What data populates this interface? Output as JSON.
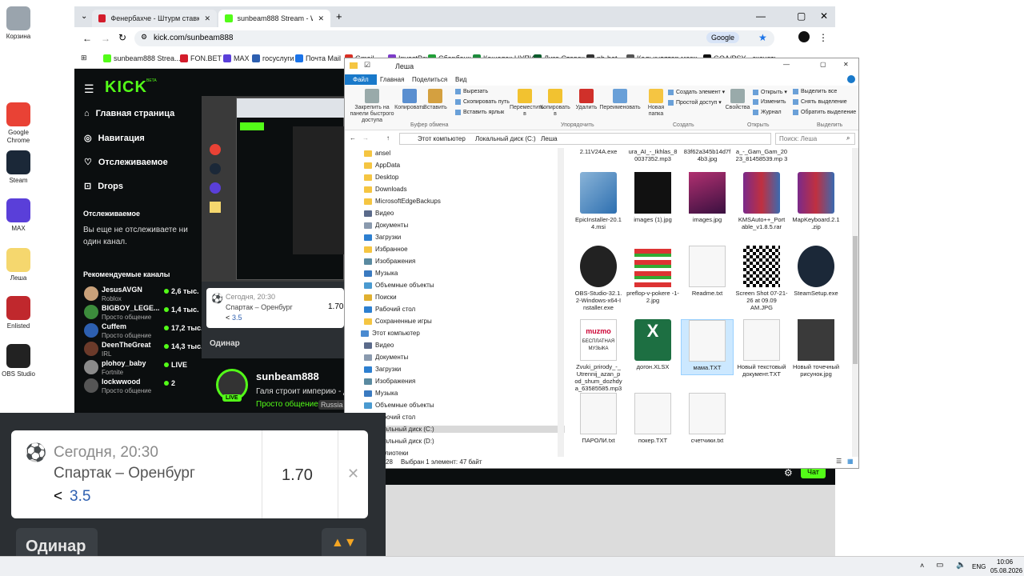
{
  "desktop": {
    "icons": [
      {
        "label": "Корзина",
        "color": "#9aa4ad"
      },
      {
        "label": "Google Chrome",
        "color": "#e94235"
      },
      {
        "label": "Steam",
        "color": "#1b2838"
      },
      {
        "label": "MAX",
        "color": "#5a3fd9"
      },
      {
        "label": "Леша",
        "color": "#f5d76e"
      },
      {
        "label": "Enlisted",
        "color": "#c0282d"
      },
      {
        "label": "OBS Studio",
        "color": "#222"
      }
    ]
  },
  "browser": {
    "tabs": [
      {
        "label": "Фенербахче - Штурм ставки ..."
      },
      {
        "label": "sunbeam888 Stream - Watch L..."
      }
    ],
    "url": "kick.com/sunbeam888",
    "google_label": "Google",
    "bookmarks": [
      "sunbeam888 Strea...",
      "FON.BET",
      "MAX",
      "госуслуги",
      "Почта Mail",
      "Gmail",
      "InvestPay",
      "Сбербанк",
      "Кошелек ЦУПИС",
      "Лига Ставок",
      "pb-bet",
      "Калькулятор маrж...",
      "GOA/PSY - скачать..."
    ]
  },
  "kick": {
    "logo": "KICK",
    "logo_beta": "BETA",
    "nav": [
      "Главная страница",
      "Навигация",
      "Отслеживаемое",
      "Drops"
    ],
    "following_title": "Отслеживаемое",
    "following_empty": "Вы еще не отслеживаете ни один канал.",
    "recommended_title": "Рекомендуемые каналы",
    "recommended": [
      {
        "name": "JesusAVGN",
        "sub": "Roblox",
        "viewers": "2,6 тыс.",
        "color": "#c9a17a"
      },
      {
        "name": "BIGBOY_LEGE...",
        "sub": "Просто общение",
        "viewers": "1,4 тыс.",
        "color": "#3c8c3c"
      },
      {
        "name": "Cuffem",
        "sub": "Просто общение",
        "viewers": "17,2 тыс.",
        "color": "#2d5fb0"
      },
      {
        "name": "DeenTheGreat",
        "sub": "IRL",
        "viewers": "14,3 тыс.",
        "color": "#6b3a2a"
      },
      {
        "name": "plohoy_baby",
        "sub": "Fortnite",
        "viewers": "LIVE",
        "color": "#8a8a8a"
      },
      {
        "name": "lockwwood",
        "sub": "Просто общение",
        "viewers": "2",
        "color": "#555"
      }
    ],
    "streamer": "sunbeam888",
    "stream_title": "Галя строит империю - д",
    "category": "Просто общение",
    "lang": "Russia",
    "live_badge": "LIVE",
    "chat_btn": "Чат"
  },
  "bet_small": {
    "time": "Сегодня, 20:30",
    "match": "Спартак – Оренбург",
    "sel_prefix": "<",
    "sel_val": "3.5",
    "odds": "1.70",
    "mode": "Одинар"
  },
  "bet_big": {
    "time": "Сегодня, 20:30",
    "match": "Спартак – Оренбург",
    "sel_prefix": "<",
    "sel_val": "3.5",
    "odds": "1.70",
    "mode": "Одинар"
  },
  "explorer": {
    "title": "Леша",
    "tabs": [
      "Файл",
      "Главная",
      "Поделиться",
      "Вид"
    ],
    "ribbon": {
      "clipboard": [
        "Закрепить на панели быстрого доступа",
        "Копировать",
        "Вставить"
      ],
      "clipboard_small": [
        "Вырезать",
        "Скопировать путь",
        "Вставить ярлык"
      ],
      "organize": [
        "Переместить в",
        "Копировать в",
        "Удалить",
        "Переименовать"
      ],
      "create": [
        "Новая папка"
      ],
      "create_small": [
        "Создать элемент ▾",
        "Простой доступ ▾"
      ],
      "open": [
        "Свойства"
      ],
      "open_small": [
        "Открыть ▾",
        "Изменить",
        "Журнал"
      ],
      "select_small": [
        "Выделить все",
        "Снять выделение",
        "Обратить выделение"
      ],
      "groups": [
        "Буфер обмена",
        "Упорядочить",
        "Создать",
        "Открыть",
        "Выделить"
      ]
    },
    "path": [
      "Этот компьютер",
      "Локальный диск (C:)",
      "Леша"
    ],
    "search_placeholder": "Поиск: Леша",
    "tree": [
      "ansel",
      "AppData",
      "Desktop",
      "Downloads",
      "MicrosoftEdgeBackups",
      "Видео",
      "Документы",
      "Загрузки",
      "Избранное",
      "Изображения",
      "Музыка",
      "Объемные объекты",
      "Поиски",
      "Рабочий стол",
      "Сохраненные игры",
      "Этот компьютер",
      "Видео",
      "Документы",
      "Загрузки",
      "Изображения",
      "Музыка",
      "Объемные объекты",
      "Рабочий стол",
      "Локальный диск (C:)",
      "Локальный диск (D:)",
      "Библиотеки"
    ],
    "top_files": [
      "2.11V24A.exe",
      "ura_AI_-_Ikhlas_8 0037352.mp3",
      "83f62a345b14d7f 4b3.jpg",
      "a_-_Gam_Gam_20 23_81458539.mp 3"
    ],
    "files": [
      {
        "name": "EpicInstaller-20.1 4.msi",
        "kind": "msi"
      },
      {
        "name": "images (1).jpg",
        "kind": "dark"
      },
      {
        "name": "images.jpg",
        "kind": "photo"
      },
      {
        "name": "KMSAuto++_Port able_v1.8.5.rar",
        "kind": "rar"
      },
      {
        "name": "MapKeyboard.2.1 .zip",
        "kind": "rar"
      },
      {
        "name": "OBS-Studio-32.1. 2-Windows-x64-I nstaller.exe",
        "kind": "obs"
      },
      {
        "name": "preflop-v-pokere -1-2.jpg",
        "kind": "chart"
      },
      {
        "name": "Readme.txt",
        "kind": "doc"
      },
      {
        "name": "Screen Shot 07-21-26 at 09.09 AM.JPG",
        "kind": "qr"
      },
      {
        "name": "SteamSetup.exe",
        "kind": "steam"
      },
      {
        "name": "Zvuki_prirody_-_ Utrennij_azan_p od_shum_dozhdy a_63585585.mp3",
        "kind": "music"
      },
      {
        "name": "догон.XLSX",
        "kind": "xlsx"
      },
      {
        "name": "мама.TXT",
        "kind": "doc"
      },
      {
        "name": "Новый текстовый документ.TXT",
        "kind": "doc"
      },
      {
        "name": "Новый точечный рисунок.jpg",
        "kind": "black"
      },
      {
        "name": "ПАРОЛИ.txt",
        "kind": "doc"
      },
      {
        "name": "покер.TXT",
        "kind": "doc"
      },
      {
        "name": "счетчики.txt",
        "kind": "doc"
      }
    ],
    "music_text1": "muzmo",
    "music_text2": "БЕСПЛАТНАЯ МУЗЫКА",
    "status_count": "28",
    "status_selected": "Выбран 1 элемент: 47 байт"
  },
  "taskbar": {
    "lang": "ENG",
    "time": "10:06",
    "date": "05.08.2026"
  }
}
